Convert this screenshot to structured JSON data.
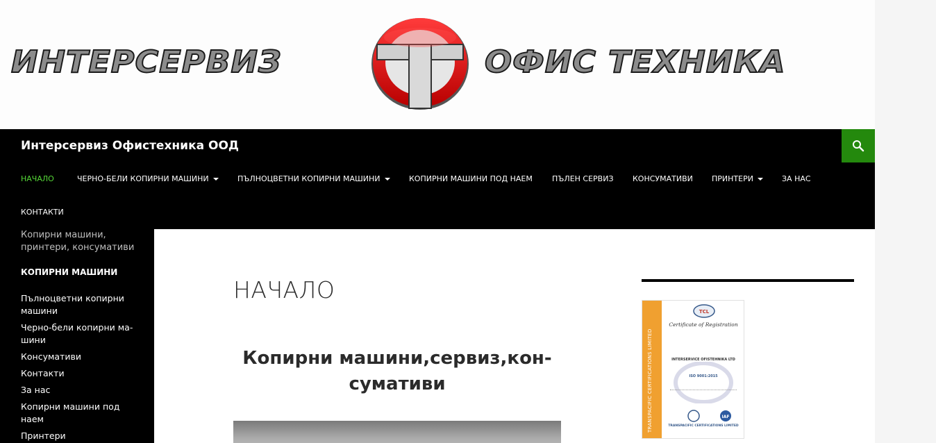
{
  "banner": {
    "logo_left": "ИНТЕРСЕРВИЗ",
    "logo_right": "ОФИС ТЕХНИКА"
  },
  "site": {
    "title": "Интерсервиз Офистехника ООД",
    "search_icon": "search-icon"
  },
  "nav": {
    "items": [
      {
        "label": "Начало",
        "active": true
      },
      {
        "label": "Черно-бели копирни машини",
        "dropdown": true
      },
      {
        "label": "Пълноцветни копирни машини",
        "dropdown": true
      },
      {
        "label": "Копирни машини под наем"
      },
      {
        "label": "Пълен сервиз"
      },
      {
        "label": "Консумативи"
      },
      {
        "label": "Принтери",
        "dropdown": true
      },
      {
        "label": "За нас"
      },
      {
        "label": "Контакти"
      }
    ]
  },
  "sidebar": {
    "tagline": "Копирни машини, принтери, консумативи",
    "widget_title": "Копирни машини",
    "links": [
      "Пълноцветни копирни машини",
      "Черно-бели копирни ма­шини",
      "Консумативи",
      "Контакти",
      "За нас",
      "Копирни машини под наем",
      "Принтери"
    ]
  },
  "main": {
    "entry_title": "Начало",
    "post_heading": "Копирни машини,сервиз,кон­сумативи"
  },
  "certificate": {
    "strip_text": "TRANSPACIFIC CERTIFICATIONS LIMITED",
    "title": "Certificate of Registration",
    "company": "INTERSERVICE OFISTEHNIKA LTD",
    "standard": "ISO 9001:2015",
    "footer": "TRANSPACIFIC CERTIFICATIONS LIMITED"
  },
  "colors": {
    "accent_green": "#24890d",
    "active_nav": "#55d737",
    "masthead_bg": "#000000"
  }
}
